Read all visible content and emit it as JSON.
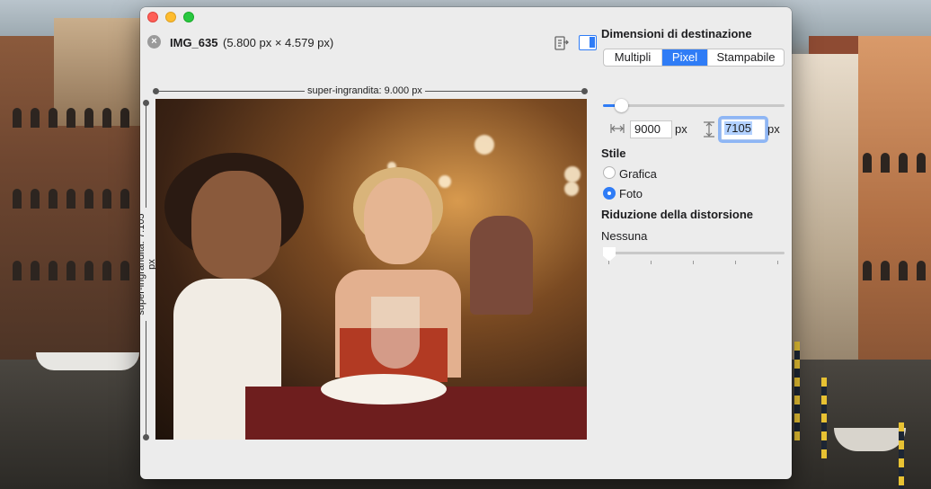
{
  "window": {
    "file_name": "IMG_635",
    "file_dims": "(5.800 px × 4.579 px)"
  },
  "preview": {
    "width_label": "super-ingrandita: 9.000 px",
    "height_label": "super-ingrandita: 7.105 px"
  },
  "panel": {
    "title": "Dimensioni di destinazione",
    "segments": [
      "Multipli",
      "Pixel",
      "Stampabile"
    ],
    "selected_segment": "Pixel",
    "scale_slider_fraction": 0.1,
    "width_value": "9000",
    "width_unit": "px",
    "height_value": "7105",
    "height_unit": "px",
    "style_title": "Stile",
    "style_options": [
      "Grafica",
      "Foto"
    ],
    "style_selected": "Foto",
    "distortion_title": "Riduzione della distorsione",
    "distortion_value": "Nessuna",
    "distortion_slider_fraction": 0
  },
  "icons": {
    "close": "close-circle-icon",
    "export": "export-settings-icon",
    "sidebar": "sidebar-toggle-icon",
    "width": "width-arrows-icon",
    "height": "height-arrows-icon"
  },
  "colors": {
    "accent": "#2f7cf6",
    "window_bg": "#ececec"
  }
}
